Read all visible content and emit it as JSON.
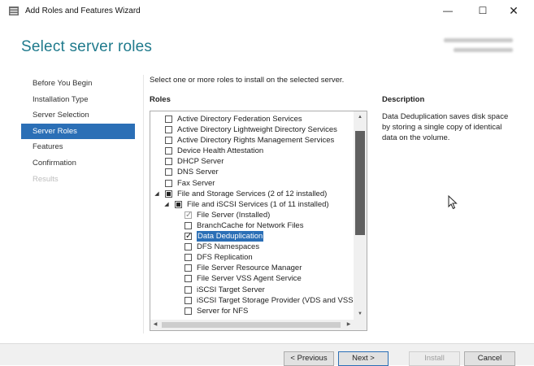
{
  "window": {
    "title": "Add Roles and Features Wizard",
    "minimize": "—",
    "maximize": "☐",
    "close": "✕"
  },
  "page": {
    "heading": "Select server roles",
    "instruction": "Select one or more roles to install on the selected server.",
    "roles_header": "Roles",
    "description_header": "Description",
    "description_text": "Data Deduplication saves disk space by storing a single copy of identical data on the volume."
  },
  "nav": {
    "items": [
      {
        "label": "Before You Begin",
        "state": "normal"
      },
      {
        "label": "Installation Type",
        "state": "normal"
      },
      {
        "label": "Server Selection",
        "state": "normal"
      },
      {
        "label": "Server Roles",
        "state": "active"
      },
      {
        "label": "Features",
        "state": "normal"
      },
      {
        "label": "Confirmation",
        "state": "normal"
      },
      {
        "label": "Results",
        "state": "disabled"
      }
    ]
  },
  "roles": [
    {
      "label": "Active Directory Federation Services",
      "checked": false,
      "level": 0
    },
    {
      "label": "Active Directory Lightweight Directory Services",
      "checked": false,
      "level": 0
    },
    {
      "label": "Active Directory Rights Management Services",
      "checked": false,
      "level": 0
    },
    {
      "label": "Device Health Attestation",
      "checked": false,
      "level": 0
    },
    {
      "label": "DHCP Server",
      "checked": false,
      "level": 0
    },
    {
      "label": "DNS Server",
      "checked": false,
      "level": 0
    },
    {
      "label": "Fax Server",
      "checked": false,
      "level": 0
    },
    {
      "label": "File and Storage Services (2 of 12 installed)",
      "checked": "partial",
      "level": 0,
      "expanded": true
    },
    {
      "label": "File and iSCSI Services (1 of 11 installed)",
      "checked": "partial",
      "level": 1,
      "expanded": true
    },
    {
      "label": "File Server (Installed)",
      "checked": true,
      "disabled": true,
      "level": 2
    },
    {
      "label": "BranchCache for Network Files",
      "checked": false,
      "level": 2
    },
    {
      "label": "Data Deduplication",
      "checked": true,
      "level": 2,
      "selected": true
    },
    {
      "label": "DFS Namespaces",
      "checked": false,
      "level": 2
    },
    {
      "label": "DFS Replication",
      "checked": false,
      "level": 2
    },
    {
      "label": "File Server Resource Manager",
      "checked": false,
      "level": 2
    },
    {
      "label": "File Server VSS Agent Service",
      "checked": false,
      "level": 2
    },
    {
      "label": "iSCSI Target Server",
      "checked": false,
      "level": 2
    },
    {
      "label": "iSCSI Target Storage Provider (VDS and VSS",
      "checked": false,
      "level": 2
    },
    {
      "label": "Server for NFS",
      "checked": false,
      "level": 2
    }
  ],
  "buttons": {
    "previous": "< Previous",
    "next": "Next >",
    "install": "Install",
    "cancel": "Cancel"
  },
  "icons": {
    "app": "server-manager-icon",
    "expanded": "triangle-expanded-icon",
    "checkbox": "checkbox-icon",
    "cursor": "mouse-pointer-icon"
  },
  "colors": {
    "heading": "#1f7a8c",
    "selection": "#2b6fb6",
    "disabled_text": "#bdbdbd"
  }
}
